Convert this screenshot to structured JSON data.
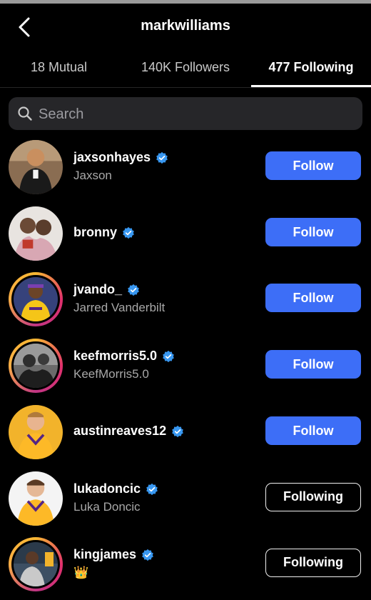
{
  "header": {
    "title": "markwilliams",
    "back_icon": "chevron-left-icon"
  },
  "tabs": [
    {
      "label": "18 Mutual",
      "active": false
    },
    {
      "label": "140K Followers",
      "active": false
    },
    {
      "label": "477 Following",
      "active": true
    }
  ],
  "search": {
    "placeholder": "Search",
    "value": ""
  },
  "colors": {
    "follow_button": "#3d6ef7",
    "verified_badge": "#3897f0",
    "background": "#000000"
  },
  "accounts": [
    {
      "username": "jaxsonhayes",
      "full_name": "Jaxson",
      "verified": true,
      "story_ring": false,
      "button": "Follow"
    },
    {
      "username": "bronny",
      "full_name": "",
      "verified": true,
      "story_ring": false,
      "button": "Follow"
    },
    {
      "username": "jvando_",
      "full_name": "Jarred Vanderbilt",
      "verified": true,
      "story_ring": true,
      "button": "Follow"
    },
    {
      "username": "keefmorris5.0",
      "full_name": "KeefMorris5.0",
      "verified": true,
      "story_ring": true,
      "button": "Follow"
    },
    {
      "username": "austinreaves12",
      "full_name": "",
      "verified": true,
      "story_ring": false,
      "button": "Follow"
    },
    {
      "username": "lukadoncic",
      "full_name": "Luka Doncic",
      "verified": true,
      "story_ring": false,
      "button": "Following"
    },
    {
      "username": "kingjames",
      "full_name": "👑",
      "verified": true,
      "story_ring": true,
      "button": "Following"
    }
  ]
}
